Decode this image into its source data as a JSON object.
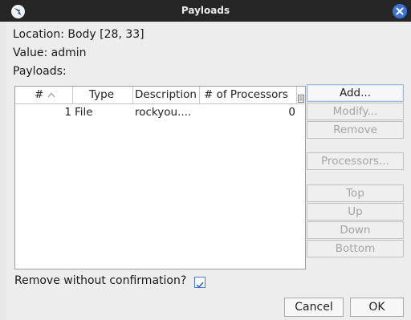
{
  "window": {
    "title": "Payloads"
  },
  "info": {
    "location": "Location: Body [28, 33]",
    "value": "Value: admin",
    "payloads_label": "Payloads:"
  },
  "table": {
    "headers": [
      "#",
      "Type",
      "Description",
      "# of Processors"
    ],
    "rows": [
      {
        "num": "1",
        "type": "File",
        "description": "rockyou....",
        "processors": "0"
      }
    ]
  },
  "buttons": {
    "add": "Add...",
    "modify": "Modify...",
    "remove": "Remove",
    "processors": "Processors...",
    "top": "Top",
    "up": "Up",
    "down": "Down",
    "bottom": "Bottom",
    "cancel": "Cancel",
    "ok": "OK"
  },
  "options": {
    "remove_confirm_label": "Remove without confirmation?",
    "remove_confirm_checked": true
  },
  "icons": {
    "app": "burp-logo-icon",
    "close": "close-icon",
    "sort": "sort-ascending-icon",
    "column_menu": "column-menu-icon",
    "check": "check-icon"
  },
  "colors": {
    "titlebar": "#262626",
    "dialog": "#ededed",
    "accent": "#3b74d4"
  }
}
